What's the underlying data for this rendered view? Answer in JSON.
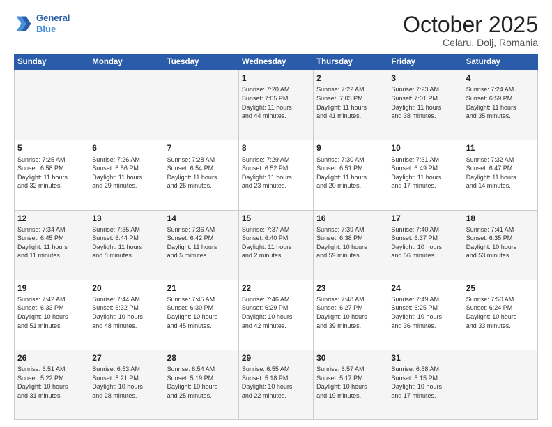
{
  "header": {
    "logo_line1": "General",
    "logo_line2": "Blue",
    "month": "October 2025",
    "location": "Celaru, Dolj, Romania"
  },
  "weekdays": [
    "Sunday",
    "Monday",
    "Tuesday",
    "Wednesday",
    "Thursday",
    "Friday",
    "Saturday"
  ],
  "weeks": [
    [
      {
        "day": "",
        "info": ""
      },
      {
        "day": "",
        "info": ""
      },
      {
        "day": "",
        "info": ""
      },
      {
        "day": "1",
        "info": "Sunrise: 7:20 AM\nSunset: 7:05 PM\nDaylight: 11 hours\nand 44 minutes."
      },
      {
        "day": "2",
        "info": "Sunrise: 7:22 AM\nSunset: 7:03 PM\nDaylight: 11 hours\nand 41 minutes."
      },
      {
        "day": "3",
        "info": "Sunrise: 7:23 AM\nSunset: 7:01 PM\nDaylight: 11 hours\nand 38 minutes."
      },
      {
        "day": "4",
        "info": "Sunrise: 7:24 AM\nSunset: 6:59 PM\nDaylight: 11 hours\nand 35 minutes."
      }
    ],
    [
      {
        "day": "5",
        "info": "Sunrise: 7:25 AM\nSunset: 6:58 PM\nDaylight: 11 hours\nand 32 minutes."
      },
      {
        "day": "6",
        "info": "Sunrise: 7:26 AM\nSunset: 6:56 PM\nDaylight: 11 hours\nand 29 minutes."
      },
      {
        "day": "7",
        "info": "Sunrise: 7:28 AM\nSunset: 6:54 PM\nDaylight: 11 hours\nand 26 minutes."
      },
      {
        "day": "8",
        "info": "Sunrise: 7:29 AM\nSunset: 6:52 PM\nDaylight: 11 hours\nand 23 minutes."
      },
      {
        "day": "9",
        "info": "Sunrise: 7:30 AM\nSunset: 6:51 PM\nDaylight: 11 hours\nand 20 minutes."
      },
      {
        "day": "10",
        "info": "Sunrise: 7:31 AM\nSunset: 6:49 PM\nDaylight: 11 hours\nand 17 minutes."
      },
      {
        "day": "11",
        "info": "Sunrise: 7:32 AM\nSunset: 6:47 PM\nDaylight: 11 hours\nand 14 minutes."
      }
    ],
    [
      {
        "day": "12",
        "info": "Sunrise: 7:34 AM\nSunset: 6:45 PM\nDaylight: 11 hours\nand 11 minutes."
      },
      {
        "day": "13",
        "info": "Sunrise: 7:35 AM\nSunset: 6:44 PM\nDaylight: 11 hours\nand 8 minutes."
      },
      {
        "day": "14",
        "info": "Sunrise: 7:36 AM\nSunset: 6:42 PM\nDaylight: 11 hours\nand 5 minutes."
      },
      {
        "day": "15",
        "info": "Sunrise: 7:37 AM\nSunset: 6:40 PM\nDaylight: 11 hours\nand 2 minutes."
      },
      {
        "day": "16",
        "info": "Sunrise: 7:39 AM\nSunset: 6:38 PM\nDaylight: 10 hours\nand 59 minutes."
      },
      {
        "day": "17",
        "info": "Sunrise: 7:40 AM\nSunset: 6:37 PM\nDaylight: 10 hours\nand 56 minutes."
      },
      {
        "day": "18",
        "info": "Sunrise: 7:41 AM\nSunset: 6:35 PM\nDaylight: 10 hours\nand 53 minutes."
      }
    ],
    [
      {
        "day": "19",
        "info": "Sunrise: 7:42 AM\nSunset: 6:33 PM\nDaylight: 10 hours\nand 51 minutes."
      },
      {
        "day": "20",
        "info": "Sunrise: 7:44 AM\nSunset: 6:32 PM\nDaylight: 10 hours\nand 48 minutes."
      },
      {
        "day": "21",
        "info": "Sunrise: 7:45 AM\nSunset: 6:30 PM\nDaylight: 10 hours\nand 45 minutes."
      },
      {
        "day": "22",
        "info": "Sunrise: 7:46 AM\nSunset: 6:29 PM\nDaylight: 10 hours\nand 42 minutes."
      },
      {
        "day": "23",
        "info": "Sunrise: 7:48 AM\nSunset: 6:27 PM\nDaylight: 10 hours\nand 39 minutes."
      },
      {
        "day": "24",
        "info": "Sunrise: 7:49 AM\nSunset: 6:25 PM\nDaylight: 10 hours\nand 36 minutes."
      },
      {
        "day": "25",
        "info": "Sunrise: 7:50 AM\nSunset: 6:24 PM\nDaylight: 10 hours\nand 33 minutes."
      }
    ],
    [
      {
        "day": "26",
        "info": "Sunrise: 6:51 AM\nSunset: 5:22 PM\nDaylight: 10 hours\nand 31 minutes."
      },
      {
        "day": "27",
        "info": "Sunrise: 6:53 AM\nSunset: 5:21 PM\nDaylight: 10 hours\nand 28 minutes."
      },
      {
        "day": "28",
        "info": "Sunrise: 6:54 AM\nSunset: 5:19 PM\nDaylight: 10 hours\nand 25 minutes."
      },
      {
        "day": "29",
        "info": "Sunrise: 6:55 AM\nSunset: 5:18 PM\nDaylight: 10 hours\nand 22 minutes."
      },
      {
        "day": "30",
        "info": "Sunrise: 6:57 AM\nSunset: 5:17 PM\nDaylight: 10 hours\nand 19 minutes."
      },
      {
        "day": "31",
        "info": "Sunrise: 6:58 AM\nSunset: 5:15 PM\nDaylight: 10 hours\nand 17 minutes."
      },
      {
        "day": "",
        "info": ""
      }
    ]
  ]
}
